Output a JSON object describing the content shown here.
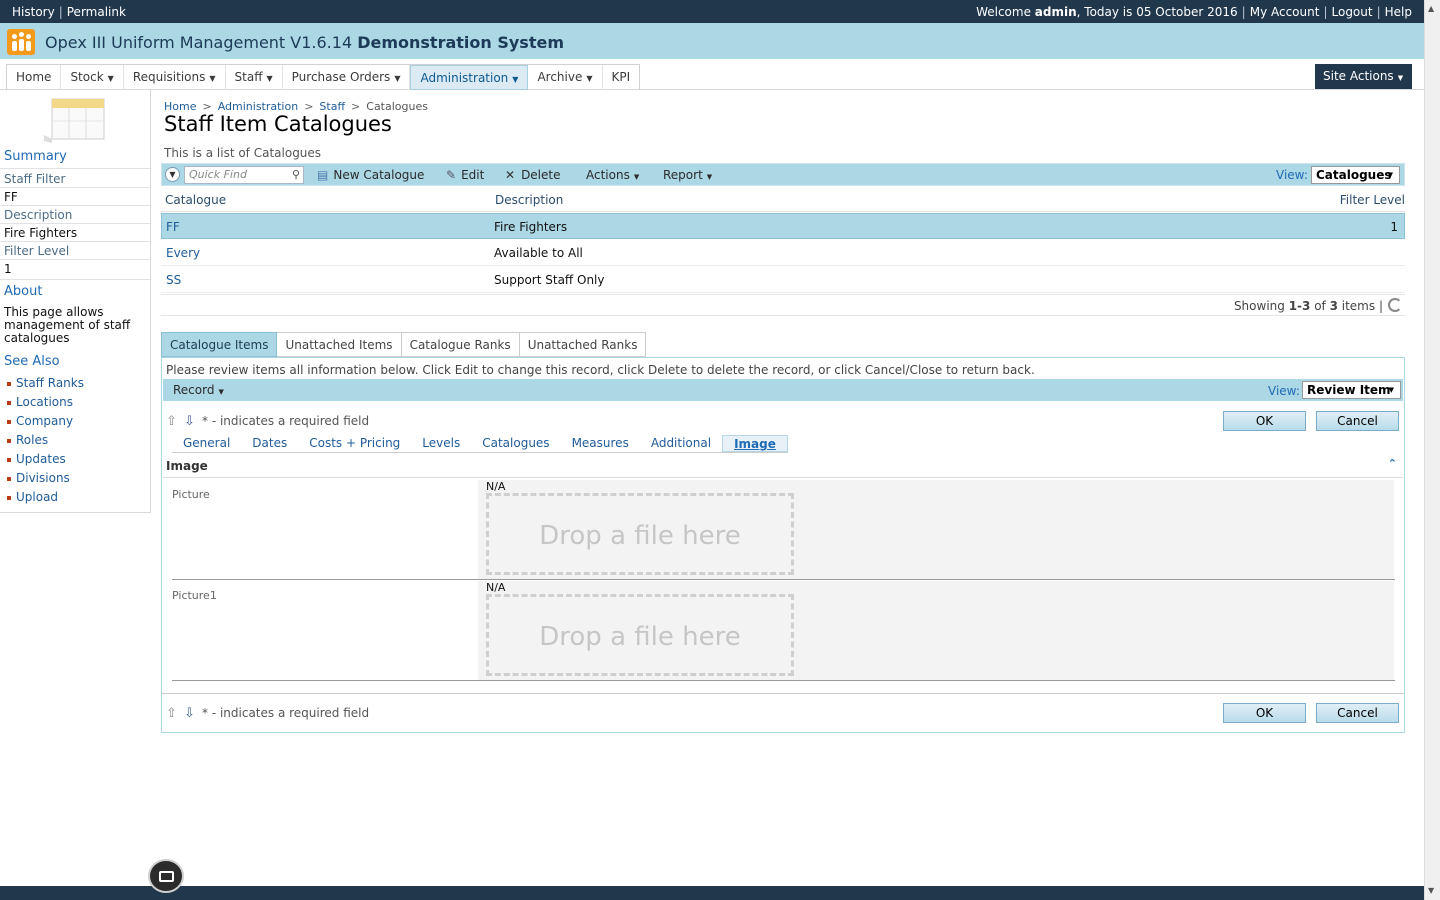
{
  "topbar": {
    "history": "History",
    "permalink": "Permalink",
    "welcome_prefix": "Welcome ",
    "user": "admin",
    "today": ", Today is 05 October 2016",
    "my_account": "My Account",
    "logout": "Logout",
    "help": "Help"
  },
  "app": {
    "title": "Opex III Uniform Management V1.6.14 ",
    "system": "Demonstration System"
  },
  "nav": {
    "items": [
      "Home",
      "Stock",
      "Requisitions",
      "Staff",
      "Purchase Orders",
      "Administration",
      "Archive",
      "KPI"
    ],
    "site_actions": "Site Actions"
  },
  "left": {
    "summary": "Summary",
    "staff_filter_label": "Staff Filter",
    "staff_filter_value": "FF",
    "description_label": "Description",
    "description_value": "Fire Fighters",
    "filter_level_label": "Filter Level",
    "filter_level_value": "1",
    "about": "About",
    "about_text": "This page allows management of staff catalogues",
    "see_also": "See Also",
    "links": [
      "Staff Ranks",
      "Locations",
      "Company",
      "Roles",
      "Updates",
      "Divisions",
      "Upload"
    ]
  },
  "breadcrumb": [
    "Home",
    "Administration",
    "Staff",
    "Catalogues"
  ],
  "page": {
    "title": "Staff Item Catalogues",
    "description": "This is a list of Catalogues"
  },
  "toolbar": {
    "quick_find_placeholder": "Quick Find",
    "new_catalogue": "New Catalogue",
    "edit": "Edit",
    "delete": "Delete",
    "actions": "Actions",
    "report": "Report",
    "view_label": "View:",
    "view_value": "Catalogues"
  },
  "grid": {
    "columns": [
      "Catalogue",
      "Description",
      "Filter Level"
    ],
    "rows": [
      {
        "catalogue": "FF",
        "description": "Fire Fighters",
        "filter_level": "1"
      },
      {
        "catalogue": "Every",
        "description": "Available to All",
        "filter_level": ""
      },
      {
        "catalogue": "SS",
        "description": "Support Staff Only",
        "filter_level": ""
      }
    ],
    "showing_prefix": "Showing ",
    "showing_range": "1-3",
    "showing_of": " of ",
    "showing_total": "3",
    "showing_suffix": " items",
    "showing_sep": "|"
  },
  "tabs": [
    "Catalogue Items",
    "Unattached Items",
    "Catalogue Ranks",
    "Unattached Ranks"
  ],
  "form": {
    "message": "Please review items all information below. Click Edit to change this record, click Delete to delete the record, or click Cancel/Close to return back.",
    "record": "Record",
    "view_label": "View:",
    "view_value": "Review Item",
    "required_note": "* - indicates a required field",
    "ok": "OK",
    "cancel": "Cancel",
    "subtabs": [
      "General",
      "Dates",
      "Costs + Pricing",
      "Levels",
      "Catalogues",
      "Measures",
      "Additional",
      "Image"
    ],
    "section": "Image",
    "fields": [
      {
        "label": "Picture",
        "value": "N/A",
        "drop_text": "Drop a file here"
      },
      {
        "label": "Picture1",
        "value": "N/A",
        "drop_text": "Drop a file here"
      }
    ]
  },
  "colors": {
    "dark_bar": "#21374c",
    "accent_blue": "#acd7e4",
    "link": "#1f5c99",
    "logo_orange": "#f39a1c"
  }
}
